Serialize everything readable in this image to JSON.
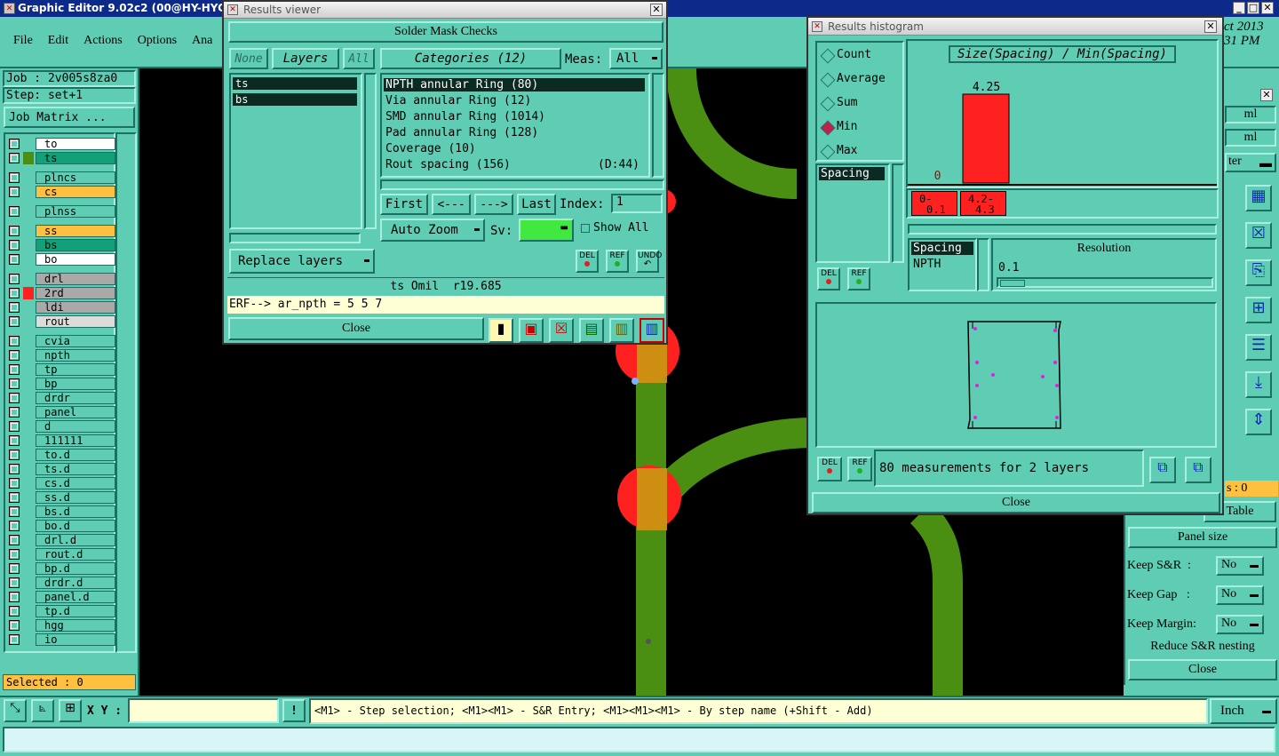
{
  "main_window": {
    "title": "Graphic Editor 9.02c2 (00@HY-HYCAM-PC",
    "menu": [
      "File",
      "Edit",
      "Actions",
      "Options",
      "Ana"
    ],
    "job_label": "Job : 2v005s8za0",
    "step_label": "Step: set+1",
    "job_matrix_btn": "Job Matrix ...",
    "selected_label": "Selected : 0",
    "date_partial_1": "ct 2013",
    "date_partial_2": "31 PM"
  },
  "layers": [
    {
      "name": "to",
      "swatch": "",
      "bg": "#ffffff"
    },
    {
      "name": "ts",
      "swatch": "#4a8f12",
      "bg": "#12a078"
    },
    {
      "name": "plncs",
      "swatch": "",
      "bg": "#5fcdb4"
    },
    {
      "name": "cs",
      "swatch": "",
      "bg": "#ffc040"
    },
    {
      "name": "plnss",
      "swatch": "",
      "bg": "#5fcdb4"
    },
    {
      "name": "ss",
      "swatch": "",
      "bg": "#ffc040"
    },
    {
      "name": "bs",
      "swatch": "",
      "bg": "#12a078"
    },
    {
      "name": "bo",
      "swatch": "",
      "bg": "#ffffff"
    },
    {
      "name": "drl",
      "swatch": "",
      "bg": "#a9a9a9"
    },
    {
      "name": "2rd",
      "swatch": "#ff2020",
      "bg": "#a9a9a9"
    },
    {
      "name": "ldi",
      "swatch": "",
      "bg": "#a9a9a9"
    },
    {
      "name": "rout",
      "swatch": "",
      "bg": "#dcdcdc"
    },
    {
      "name": "cvia",
      "swatch": "",
      "bg": "#5fcdb4"
    },
    {
      "name": "npth",
      "swatch": "",
      "bg": "#5fcdb4"
    },
    {
      "name": "tp",
      "swatch": "",
      "bg": "#5fcdb4"
    },
    {
      "name": "bp",
      "swatch": "",
      "bg": "#5fcdb4"
    },
    {
      "name": "drdr",
      "swatch": "",
      "bg": "#5fcdb4"
    },
    {
      "name": "panel",
      "swatch": "",
      "bg": "#5fcdb4"
    },
    {
      "name": "d",
      "swatch": "",
      "bg": "#5fcdb4"
    },
    {
      "name": "111111",
      "swatch": "",
      "bg": "#5fcdb4"
    },
    {
      "name": "to.d",
      "swatch": "",
      "bg": "#5fcdb4"
    },
    {
      "name": "ts.d",
      "swatch": "",
      "bg": "#5fcdb4"
    },
    {
      "name": "cs.d",
      "swatch": "",
      "bg": "#5fcdb4"
    },
    {
      "name": "ss.d",
      "swatch": "",
      "bg": "#5fcdb4"
    },
    {
      "name": "bs.d",
      "swatch": "",
      "bg": "#5fcdb4"
    },
    {
      "name": "bo.d",
      "swatch": "",
      "bg": "#5fcdb4"
    },
    {
      "name": "drl.d",
      "swatch": "",
      "bg": "#5fcdb4"
    },
    {
      "name": "rout.d",
      "swatch": "",
      "bg": "#5fcdb4"
    },
    {
      "name": "bp.d",
      "swatch": "",
      "bg": "#5fcdb4"
    },
    {
      "name": "drdr.d",
      "swatch": "",
      "bg": "#5fcdb4"
    },
    {
      "name": "panel.d",
      "swatch": "",
      "bg": "#5fcdb4"
    },
    {
      "name": "tp.d",
      "swatch": "",
      "bg": "#5fcdb4"
    },
    {
      "name": "hgg",
      "swatch": "",
      "bg": "#5fcdb4"
    },
    {
      "name": "io",
      "swatch": "",
      "bg": "#5fcdb4"
    }
  ],
  "results_viewer": {
    "title": "Results viewer",
    "header": "Solder Mask Checks",
    "none_btn": "None",
    "layers_btn": "Layers",
    "all_btn": "All",
    "layer_list": [
      "ts",
      "bs"
    ],
    "categories_label": "Categories (12)",
    "meas_label": "Meas:",
    "meas_value": "All",
    "categories": [
      {
        "text": "NPTH annular Ring (80)",
        "extra": "",
        "selected": true
      },
      {
        "text": "Via annular Ring (12)",
        "extra": "",
        "selected": false
      },
      {
        "text": "SMD annular Ring (1014)",
        "extra": "",
        "selected": false
      },
      {
        "text": "Pad annular Ring (128)",
        "extra": "",
        "selected": false
      },
      {
        "text": "Coverage (10)",
        "extra": "",
        "selected": false
      },
      {
        "text": "Rout spacing (156)",
        "extra": "(D:44)",
        "selected": false
      }
    ],
    "first_btn": "First",
    "prev_btn": "<---",
    "next_btn": "--->",
    "last_btn": "Last",
    "index_label": "Index:",
    "index_value": "1",
    "auto_zoom": "Auto Zoom",
    "sv_label": "Sv:",
    "show_all": "Show All",
    "replace_layers": "Replace layers",
    "del": "DEL",
    "ref": "REF",
    "undo": "UNDO",
    "status_line": "ts Omil  r19.685",
    "erf_line": "ERF--> ar_npth = 5 5 7",
    "close": "Close"
  },
  "histogram": {
    "title": "Results histogram",
    "modes": [
      {
        "label": "Count",
        "active": false
      },
      {
        "label": "Average",
        "active": false
      },
      {
        "label": "Sum",
        "active": false
      },
      {
        "label": "Min",
        "active": true
      },
      {
        "label": "Max",
        "active": false
      }
    ],
    "chart_title": "Size(Spacing) / Min(Spacing)",
    "list_item": "Spacing",
    "bins": [
      {
        "label_top": "0-",
        "label_bottom": "0.1",
        "value": 0,
        "value_label": "0"
      },
      {
        "label_top": "4.2-",
        "label_bottom": "4.3",
        "value": 4.25,
        "value_label": "4.25"
      }
    ],
    "detail_items": [
      "Spacing",
      "NPTH"
    ],
    "resolution_label": "Resolution",
    "resolution_value": "0.1",
    "measurements_text": "80 measurements for 2 layers",
    "del": "DEL",
    "ref": "REF",
    "close": "Close"
  },
  "right_panel": {
    "units_1": "ml",
    "units_2": "ml",
    "filter_partial": "ter",
    "count_partial": "s : 0",
    "table_btn": "Table",
    "panel_size": "Panel size",
    "keep_sr_label": "Keep S&R  :",
    "keep_sr_value": "No",
    "keep_gap_label": "Keep Gap   :",
    "keep_gap_value": "No",
    "keep_margin_label": "Keep Margin:",
    "keep_margin_value": "No",
    "reduce": "Reduce S&R nesting",
    "close": "Close"
  },
  "bottom": {
    "xy_label": "X Y :",
    "xy_value": "",
    "exclaim": "!",
    "hint": "<M1> - Step selection; <M1><M1> - S&R Entry; <M1><M1><M1> - By step name (+Shift - Add)",
    "units": "Inch"
  },
  "colors": {
    "panel_bg": "#5fcdb4",
    "canvas_bg": "#000000",
    "trace_green": "#4a8f12",
    "pad_red": "#ff2020",
    "selected_row": "#0a2a22"
  }
}
